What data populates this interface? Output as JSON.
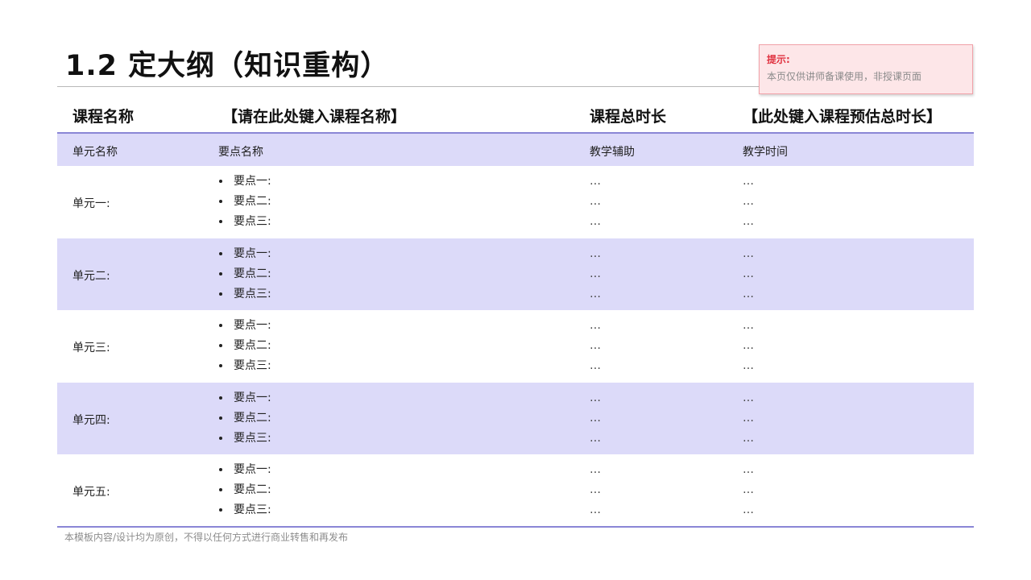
{
  "title": "1.2 定大纲（知识重构）",
  "tip": {
    "title": "提示:",
    "text": "本页仅供讲师备课使用，非授课页面"
  },
  "header": {
    "course_name_label": "课程名称",
    "course_name_value": "【请在此处键入课程名称】",
    "course_duration_label": "课程总时长",
    "course_duration_value": "【此处键入课程预估总时长】"
  },
  "columns": [
    "单元名称",
    "要点名称",
    "教学辅助",
    "教学时间"
  ],
  "rows": [
    {
      "unit": "单元一:",
      "points": [
        "要点一:",
        "要点二:",
        "要点三:"
      ],
      "aids": [
        "…",
        "…",
        "…"
      ],
      "times": [
        "…",
        "…",
        "…"
      ]
    },
    {
      "unit": "单元二:",
      "points": [
        "要点一:",
        "要点二:",
        "要点三:"
      ],
      "aids": [
        "…",
        "…",
        "…"
      ],
      "times": [
        "…",
        "…",
        "…"
      ]
    },
    {
      "unit": "单元三:",
      "points": [
        "要点一:",
        "要点二:",
        "要点三:"
      ],
      "aids": [
        "…",
        "…",
        "…"
      ],
      "times": [
        "…",
        "…",
        "…"
      ]
    },
    {
      "unit": "单元四:",
      "points": [
        "要点一:",
        "要点二:",
        "要点三:"
      ],
      "aids": [
        "…",
        "…",
        "…"
      ],
      "times": [
        "…",
        "…",
        "…"
      ]
    },
    {
      "unit": "单元五:",
      "points": [
        "要点一:",
        "要点二:",
        "要点三:"
      ],
      "aids": [
        "…",
        "…",
        "…"
      ],
      "times": [
        "…",
        "…",
        "…"
      ]
    }
  ],
  "footer": "本模板内容/设计均为原创，不得以任何方式进行商业转售和再发布",
  "colors": {
    "accent_line": "#8a86d6",
    "row_shade": "#dcdaf9",
    "tip_bg": "#fde6e8",
    "tip_title": "#e0313f"
  }
}
